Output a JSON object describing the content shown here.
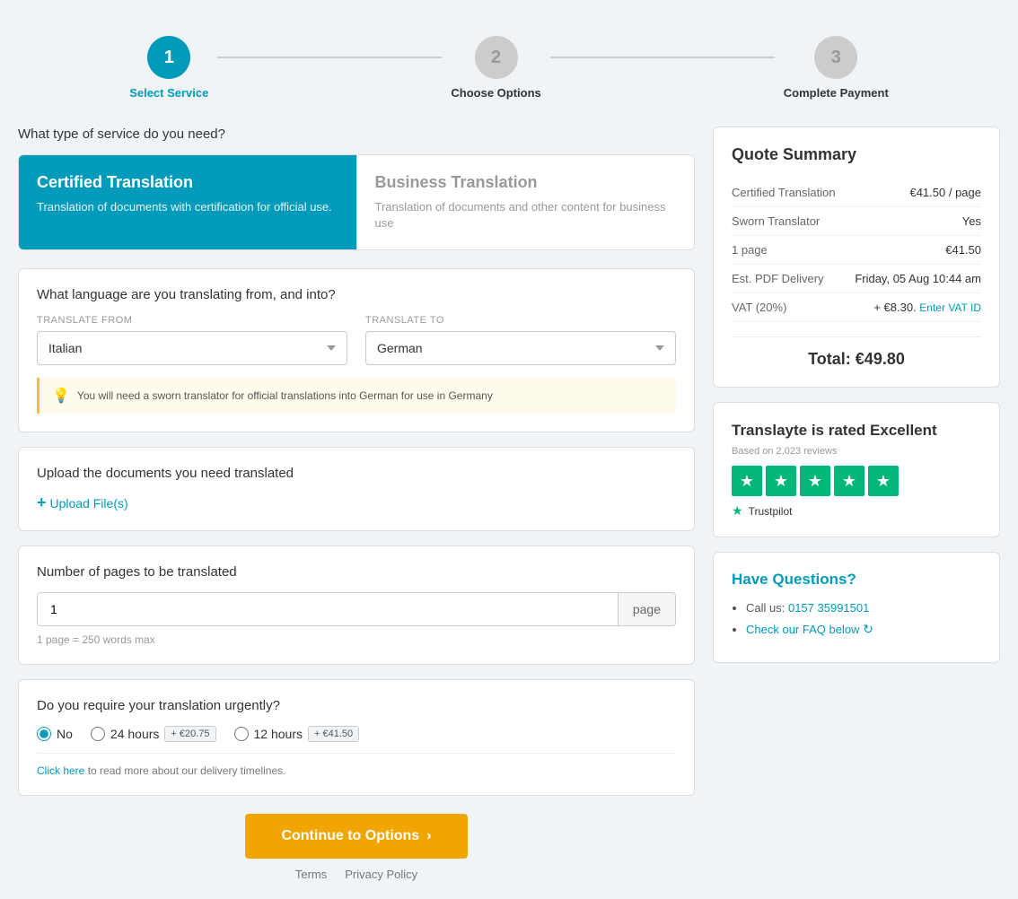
{
  "stepper": {
    "steps": [
      {
        "number": "1",
        "label": "Select Service",
        "state": "active"
      },
      {
        "number": "2",
        "label": "Choose Options",
        "state": "inactive"
      },
      {
        "number": "3",
        "label": "Complete Payment",
        "state": "inactive"
      }
    ]
  },
  "service_section": {
    "question": "What type of service do you need?",
    "cards": [
      {
        "title": "Certified Translation",
        "description": "Translation of documents with certification for official use.",
        "selected": true
      },
      {
        "title": "Business Translation",
        "description": "Translation of documents and other content for business use",
        "selected": false
      }
    ]
  },
  "language_section": {
    "question": "What language are you translating from, and into?",
    "from_label": "Translate From",
    "to_label": "Translate To",
    "from_value": "Italian",
    "to_value": "German",
    "warning": "You will need a sworn translator for official translations into German for use in Germany"
  },
  "upload_section": {
    "label": "Upload the documents you need translated",
    "button": "+ Upload File(s)"
  },
  "pages_section": {
    "label": "Number of pages to be translated",
    "value": "1",
    "suffix": "page",
    "hint": "1 page = 250 words max"
  },
  "urgency_section": {
    "question": "Do you require your translation urgently?",
    "options": [
      {
        "id": "no",
        "label": "No",
        "badge": "",
        "selected": true
      },
      {
        "id": "24h",
        "label": "24 hours",
        "badge": "+ €20.75",
        "selected": false
      },
      {
        "id": "12h",
        "label": "12 hours",
        "badge": "+ €41.50",
        "selected": false
      }
    ],
    "delivery_text": "Click here to read more about our delivery timelines."
  },
  "continue_button": "Continue to Options",
  "continue_arrow": "›",
  "footer": {
    "terms": "Terms",
    "privacy": "Privacy Policy"
  },
  "quote": {
    "title": "Quote Summary",
    "rows": [
      {
        "key": "Certified Translation",
        "value": "€41.50 / page"
      },
      {
        "key": "Sworn Translator",
        "value": "Yes"
      },
      {
        "key": "1 page",
        "value": "€41.50"
      },
      {
        "key": "Est. PDF Delivery",
        "value": "Friday, 05 Aug 10:44 am"
      },
      {
        "key": "VAT (20%)",
        "value": "+ €8.30.",
        "vat_link": "Enter VAT ID"
      }
    ],
    "total_label": "Total:",
    "total_value": "€49.80"
  },
  "trustpilot": {
    "title": "Translayte is rated Excellent",
    "based_on": "Based on 2,023 reviews",
    "stars_count": 5,
    "logo_text": "Trustpilot"
  },
  "questions": {
    "title": "Have Questions?",
    "items": [
      {
        "text": "Call us: 0157 35991501",
        "link": "0157 35991501"
      },
      {
        "text": "Check our FAQ below",
        "link": "Check our FAQ below",
        "icon": "↻"
      }
    ]
  }
}
